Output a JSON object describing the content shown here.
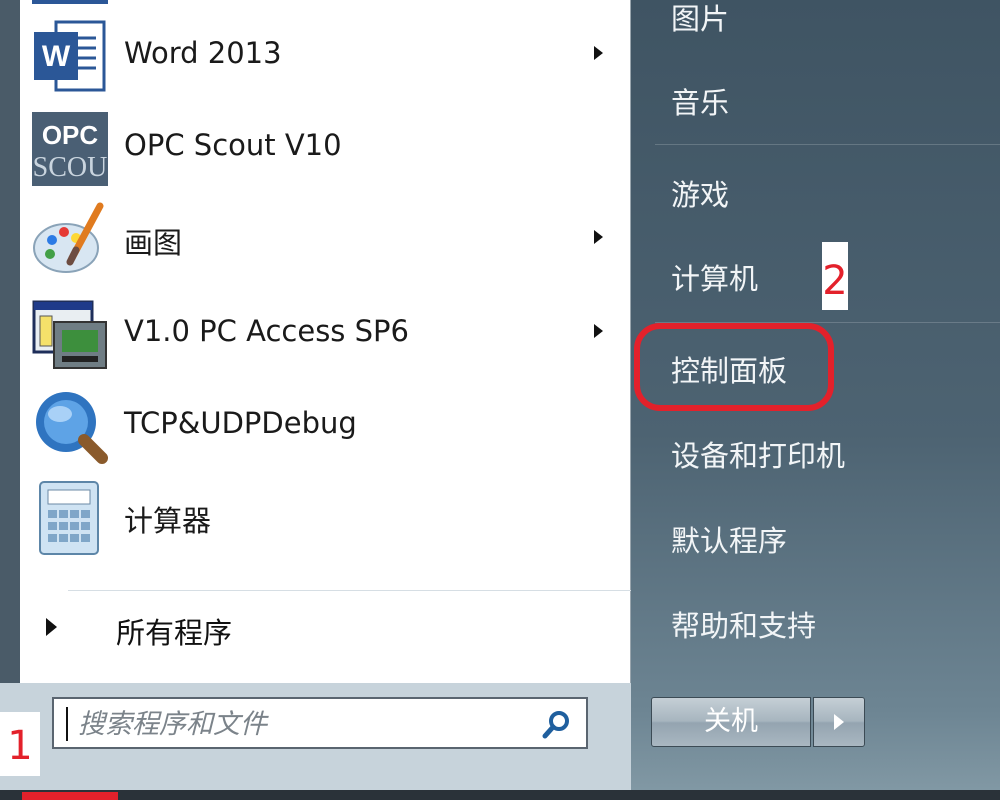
{
  "programs": [
    {
      "label": "Word 2013",
      "icon": "word-icon",
      "has_submenu": true
    },
    {
      "label": "OPC Scout V10",
      "icon": "opc-scout-icon",
      "has_submenu": false,
      "icon_text_top": "OPC",
      "icon_text_bottom": "SCOU"
    },
    {
      "label": "画图",
      "icon": "paint-icon",
      "has_submenu": true
    },
    {
      "label": "V1.0 PC Access SP6",
      "icon": "pc-access-icon",
      "has_submenu": true
    },
    {
      "label": "TCP&UDPDebug",
      "icon": "tcp-udp-debug-icon",
      "has_submenu": false
    },
    {
      "label": "计算器",
      "icon": "calculator-icon",
      "has_submenu": false
    }
  ],
  "all_programs_label": "所有程序",
  "search": {
    "placeholder": "搜索程序和文件"
  },
  "right_pane": {
    "items": [
      "图片",
      "音乐",
      "游戏",
      "计算机",
      "控制面板",
      "设备和打印机",
      "默认程序",
      "帮助和支持"
    ],
    "highlighted": "控制面板"
  },
  "shutdown": {
    "label": "关机"
  },
  "annotations": {
    "step1": "1",
    "step2": "2"
  },
  "colors": {
    "highlight": "#e3212b",
    "right_pane": "#4d6372",
    "list_bg": "#ffffff"
  }
}
